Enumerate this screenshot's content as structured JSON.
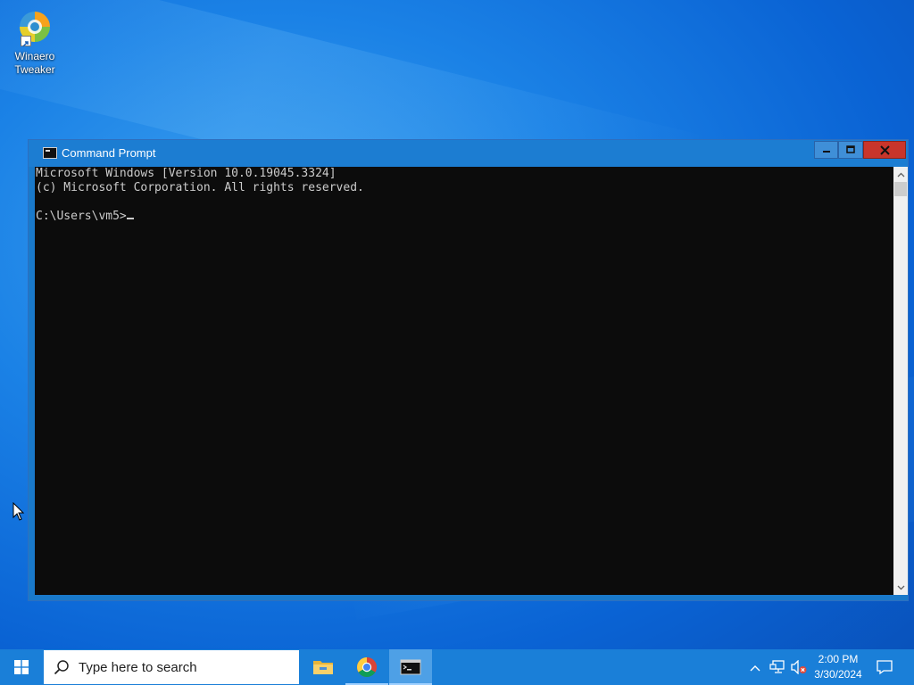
{
  "desktop": {
    "icons": [
      {
        "label_line1": "Winaero",
        "label_line2": "Tweaker",
        "icon": "winaero-tweaker-icon"
      }
    ]
  },
  "window": {
    "title": "Command Prompt",
    "icon": "command-prompt-icon",
    "controls": {
      "minimize": "minimize-icon",
      "maximize": "maximize-icon",
      "close": "close-icon"
    },
    "console_lines": [
      "Microsoft Windows [Version 10.0.19045.3324]",
      "(c) Microsoft Corporation. All rights reserved.",
      "",
      "C:\\Users\\vm5>"
    ]
  },
  "taskbar": {
    "search_placeholder": "Type here to search",
    "apps": [
      {
        "name": "File Explorer",
        "icon": "folder-icon"
      },
      {
        "name": "Google Chrome",
        "icon": "chrome-icon"
      },
      {
        "name": "Command Prompt",
        "icon": "command-prompt-icon",
        "active": true
      }
    ],
    "tray": {
      "time": "2:00 PM",
      "date": "3/30/2024"
    }
  },
  "colors": {
    "taskbar": "#1a7fd8",
    "console_bg": "#0c0c0c",
    "console_text": "#cccccc",
    "close_button": "#c9352b"
  }
}
